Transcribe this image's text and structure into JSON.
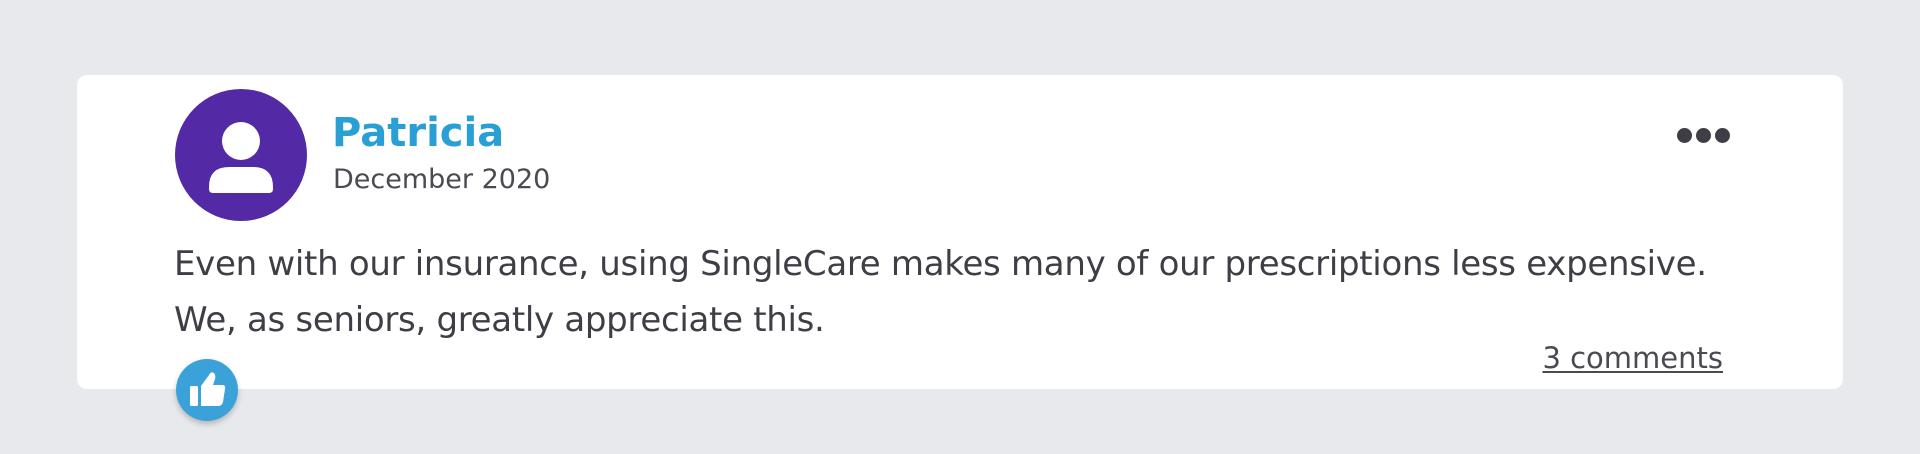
{
  "review": {
    "author_name": "Patricia",
    "date": "December 2020",
    "text": "Even with our insurance, using SingleCare makes many of our prescriptions less expensive.\nWe, as seniors, greatly appreciate this.",
    "comments_label": "3 comments"
  },
  "icons": {
    "avatar": "user-icon",
    "more": "more-dots-icon",
    "like": "thumbs-up-icon"
  },
  "colors": {
    "page_background": "#e8e9ec",
    "card_background": "#ffffff",
    "avatar_background": "#5429a5",
    "author_name": "#2a9fd6",
    "like_button": "#3aa2d8",
    "text": "#3f3e46"
  }
}
